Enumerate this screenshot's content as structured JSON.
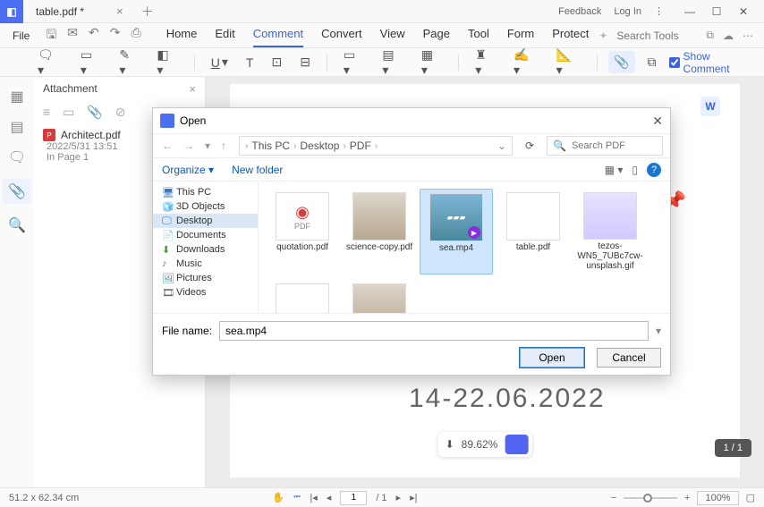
{
  "titlebar": {
    "tab_name": "table.pdf *",
    "feedback": "Feedback",
    "login": "Log In"
  },
  "menubar": {
    "file": "File",
    "tabs": [
      "Home",
      "Edit",
      "Comment",
      "Convert",
      "View",
      "Page",
      "Tool",
      "Form",
      "Protect"
    ],
    "active_tab": "Comment",
    "search_placeholder": "Search Tools"
  },
  "ribbon": {
    "show_comment": "Show Comment"
  },
  "panel": {
    "title": "Attachment",
    "file": "Architect.pdf",
    "meta1": "2022/5/31 13:51",
    "meta2": "In Page 1"
  },
  "canvas": {
    "big_date": "14-22.06.2022",
    "zoom_chip": "89.62%",
    "page_indicator": "1 / 1"
  },
  "statusbar": {
    "dims": "51.2 x 62.34 cm",
    "page": "1",
    "page_total": "/ 1",
    "zoom": "100%"
  },
  "dialog": {
    "title": "Open",
    "path": [
      "This PC",
      "Desktop",
      "PDF"
    ],
    "search_placeholder": "Search PDF",
    "organize": "Organize",
    "new_folder": "New folder",
    "tree": [
      "This PC",
      "3D Objects",
      "Desktop",
      "Documents",
      "Downloads",
      "Music",
      "Pictures",
      "Videos"
    ],
    "tree_selected": "Desktop",
    "files": [
      {
        "name": "quotation.pdf",
        "kind": "pdf-icon"
      },
      {
        "name": "science-copy.pdf",
        "kind": "image"
      },
      {
        "name": "sea.mp4",
        "kind": "video",
        "selected": true
      },
      {
        "name": "table.pdf",
        "kind": "plain"
      },
      {
        "name": "tezos-WN5_7UBc7cw-unsplash.gif",
        "kind": "tezos"
      },
      {
        "name": "",
        "kind": "plain"
      },
      {
        "name": "",
        "kind": "image"
      }
    ],
    "filename_label": "File name:",
    "filename_value": "sea.mp4",
    "open_btn": "Open",
    "cancel_btn": "Cancel"
  }
}
